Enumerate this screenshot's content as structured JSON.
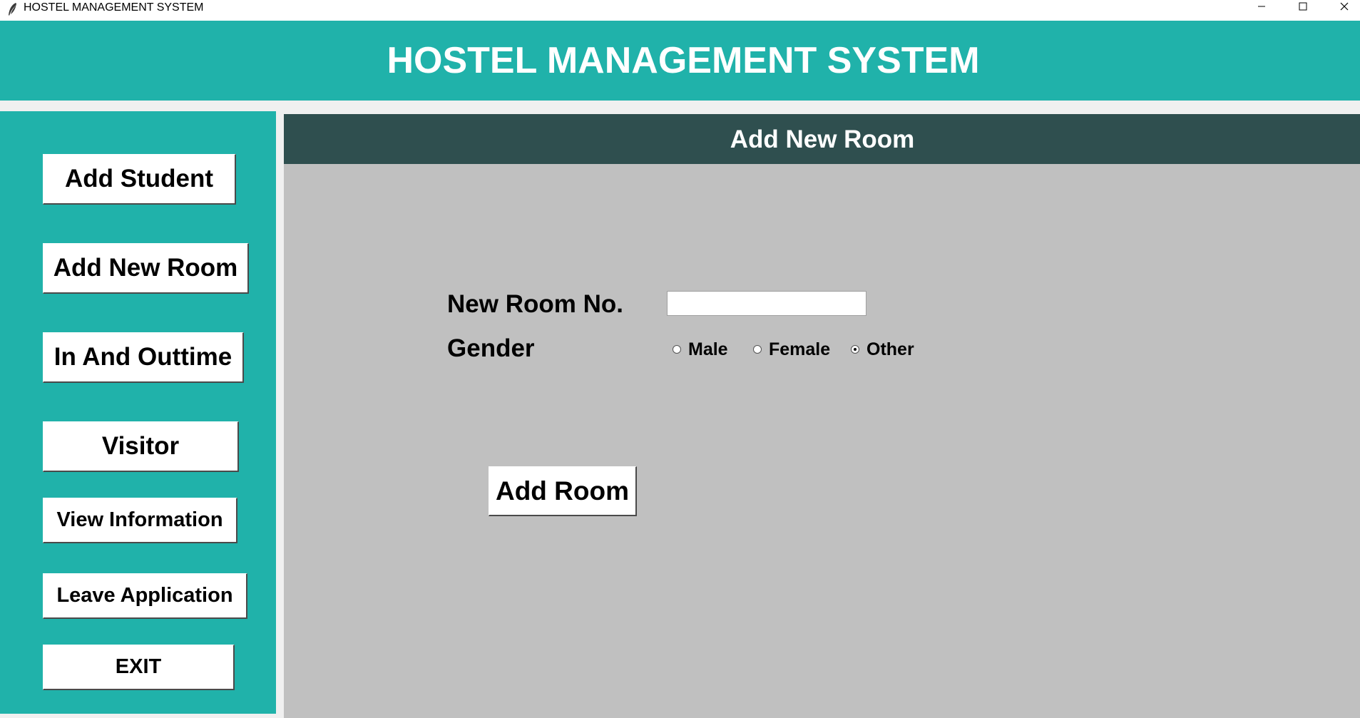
{
  "window": {
    "title": "HOSTEL MANAGEMENT SYSTEM",
    "controls": {
      "minimize_icon": "minimize-icon",
      "maximize_icon": "maximize-icon",
      "close_icon": "close-icon"
    }
  },
  "header": {
    "title": "HOSTEL MANAGEMENT SYSTEM"
  },
  "sidebar": {
    "items": [
      {
        "label": "Add Student"
      },
      {
        "label": "Add New Room"
      },
      {
        "label": "In And Outtime"
      },
      {
        "label": "Visitor"
      },
      {
        "label": "View Information"
      },
      {
        "label": "Leave Application"
      },
      {
        "label": "EXIT"
      }
    ]
  },
  "form": {
    "title": "Add New Room",
    "room_no_label": "New Room No.",
    "room_no_value": "",
    "gender_label": "Gender",
    "gender_options": [
      {
        "label": "Male",
        "selected": false
      },
      {
        "label": "Female",
        "selected": false
      },
      {
        "label": "Other",
        "selected": true
      }
    ],
    "submit_label": "Add Room"
  },
  "colors": {
    "accent": "#20b2aa",
    "form_header": "#2f4f4f",
    "form_background": "#c0c0c0",
    "button": "#ffffff"
  }
}
